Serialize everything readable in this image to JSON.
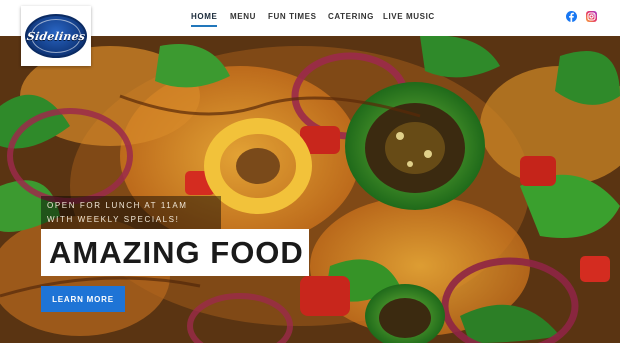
{
  "brand": {
    "logo_text": "Sidelines",
    "accent_color": "#1e74d6"
  },
  "nav": {
    "items": [
      {
        "label": "HOME",
        "active": true
      },
      {
        "label": "MENU",
        "active": false
      },
      {
        "label": "FUN TIMES",
        "active": false
      },
      {
        "label": "CATERING",
        "active": false
      },
      {
        "label": "LIVE MUSIC",
        "active": false
      }
    ],
    "social": [
      {
        "icon": "facebook-icon",
        "color": "#1877f2"
      },
      {
        "icon": "instagram-icon",
        "color": "#e1306c"
      }
    ]
  },
  "hero": {
    "promo_line1": "OPEN FOR LUNCH AT 11AM",
    "promo_line2": "WITH WEEKLY SPECIALS!",
    "headline": "AMAZING FOOD",
    "cta_label": "LEARN MORE"
  }
}
